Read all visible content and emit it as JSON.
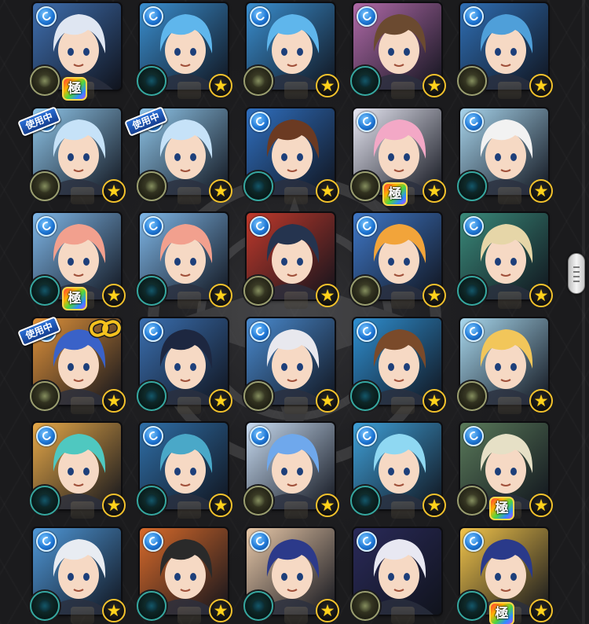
{
  "screen": {
    "title": "",
    "selected_tag": "使用中"
  },
  "icons": {
    "element": "water-orb-icon",
    "slot": "luck-skill-slot-icon",
    "star": "gold-star-icon",
    "kiwami": "極",
    "link": "chain-link-icon"
  },
  "star_glyph": "★",
  "cards": [
    {
      "hair": "#dfe6f2",
      "bg": "#3f6fb0",
      "slot": "olive",
      "star": false,
      "kiwami": true,
      "in_use": false,
      "link": false
    },
    {
      "hair": "#5fb6ec",
      "bg": "#3a8fd0",
      "slot": "teal",
      "star": true,
      "kiwami": false,
      "in_use": false,
      "link": false
    },
    {
      "hair": "#5fb6ec",
      "bg": "#3a8fd0",
      "slot": "olive",
      "star": true,
      "kiwami": false,
      "in_use": false,
      "link": false
    },
    {
      "hair": "#6b4a30",
      "bg": "#b06aa8",
      "slot": "teal",
      "star": true,
      "kiwami": false,
      "in_use": false,
      "link": false
    },
    {
      "hair": "#4f9fd9",
      "bg": "#2f6fb5",
      "slot": "olive",
      "star": true,
      "kiwami": false,
      "in_use": false,
      "link": false
    },
    {
      "hair": "#c6e2f8",
      "bg": "#8fc6ea",
      "slot": "olive",
      "star": true,
      "kiwami": false,
      "in_use": true,
      "link": false
    },
    {
      "hair": "#c6e2f8",
      "bg": "#8fc6ea",
      "slot": "olive",
      "star": true,
      "kiwami": false,
      "in_use": true,
      "link": false
    },
    {
      "hair": "#6b3a22",
      "bg": "#2f6fbf",
      "slot": "teal",
      "star": true,
      "kiwami": false,
      "in_use": false,
      "link": false
    },
    {
      "hair": "#f3a8c6",
      "bg": "#e8e8f4",
      "slot": "olive",
      "star": true,
      "kiwami": true,
      "in_use": false,
      "link": false
    },
    {
      "hair": "#f2f2f2",
      "bg": "#a7d4ec",
      "slot": "teal",
      "star": true,
      "kiwami": false,
      "in_use": false,
      "link": false
    },
    {
      "hair": "#f2a08e",
      "bg": "#7fb7e8",
      "slot": "teal",
      "star": true,
      "kiwami": true,
      "in_use": false,
      "link": false
    },
    {
      "hair": "#f2a08e",
      "bg": "#7fb7e8",
      "slot": "teal",
      "star": true,
      "kiwami": false,
      "in_use": false,
      "link": false
    },
    {
      "hair": "#25344f",
      "bg": "#c0392b",
      "slot": "olive",
      "star": true,
      "kiwami": false,
      "in_use": false,
      "link": false
    },
    {
      "hair": "#f2a43a",
      "bg": "#3f78c8",
      "slot": "olive",
      "star": true,
      "kiwami": false,
      "in_use": false,
      "link": false
    },
    {
      "hair": "#e6d6a8",
      "bg": "#3a8a7a",
      "slot": "teal",
      "star": true,
      "kiwami": false,
      "in_use": false,
      "link": false
    },
    {
      "hair": "#3a62c8",
      "bg": "#e0923a",
      "slot": "olive",
      "star": true,
      "kiwami": false,
      "in_use": true,
      "link": true
    },
    {
      "hair": "#1d2740",
      "bg": "#3a6fb0",
      "slot": "teal",
      "star": true,
      "kiwami": false,
      "in_use": false,
      "link": false
    },
    {
      "hair": "#e8e8ee",
      "bg": "#4a8bd0",
      "slot": "olive",
      "star": true,
      "kiwami": false,
      "in_use": false,
      "link": false
    },
    {
      "hair": "#7a4a2a",
      "bg": "#2f8fd0",
      "slot": "teal",
      "star": true,
      "kiwami": false,
      "in_use": false,
      "link": false
    },
    {
      "hair": "#f2c65a",
      "bg": "#a8d8ee",
      "slot": "olive",
      "star": true,
      "kiwami": false,
      "in_use": false,
      "link": false
    },
    {
      "hair": "#4fc8c0",
      "bg": "#e6a848",
      "slot": "teal",
      "star": true,
      "kiwami": false,
      "in_use": false,
      "link": false
    },
    {
      "hair": "#4aa8c8",
      "bg": "#2f6fa8",
      "slot": "teal",
      "star": true,
      "kiwami": false,
      "in_use": false,
      "link": false
    },
    {
      "hair": "#6fa8ec",
      "bg": "#c8dcf2",
      "slot": "olive",
      "star": true,
      "kiwami": false,
      "in_use": false,
      "link": false
    },
    {
      "hair": "#8fd8f2",
      "bg": "#3fa0d8",
      "slot": "teal",
      "star": true,
      "kiwami": false,
      "in_use": false,
      "link": false
    },
    {
      "hair": "#e6e0c6",
      "bg": "#5a7a5a",
      "slot": "olive",
      "star": true,
      "kiwami": true,
      "in_use": false,
      "link": false
    },
    {
      "hair": "#e8ecf2",
      "bg": "#4f98d8",
      "slot": "teal",
      "star": true,
      "kiwami": false,
      "in_use": false,
      "link": false
    },
    {
      "hair": "#2a2a2a",
      "bg": "#d86a2a",
      "slot": "teal",
      "star": true,
      "kiwami": false,
      "in_use": false,
      "link": false
    },
    {
      "hair": "#2c3a8a",
      "bg": "#e8c8a8",
      "slot": "teal",
      "star": true,
      "kiwami": false,
      "in_use": false,
      "link": false
    },
    {
      "hair": "#e8e8f2",
      "bg": "#2a2a5a",
      "slot": "olive",
      "star": false,
      "kiwami": false,
      "in_use": false,
      "link": false
    },
    {
      "hair": "#2a3a8a",
      "bg": "#f2c44a",
      "slot": "teal",
      "star": true,
      "kiwami": true,
      "in_use": false,
      "link": false
    }
  ]
}
